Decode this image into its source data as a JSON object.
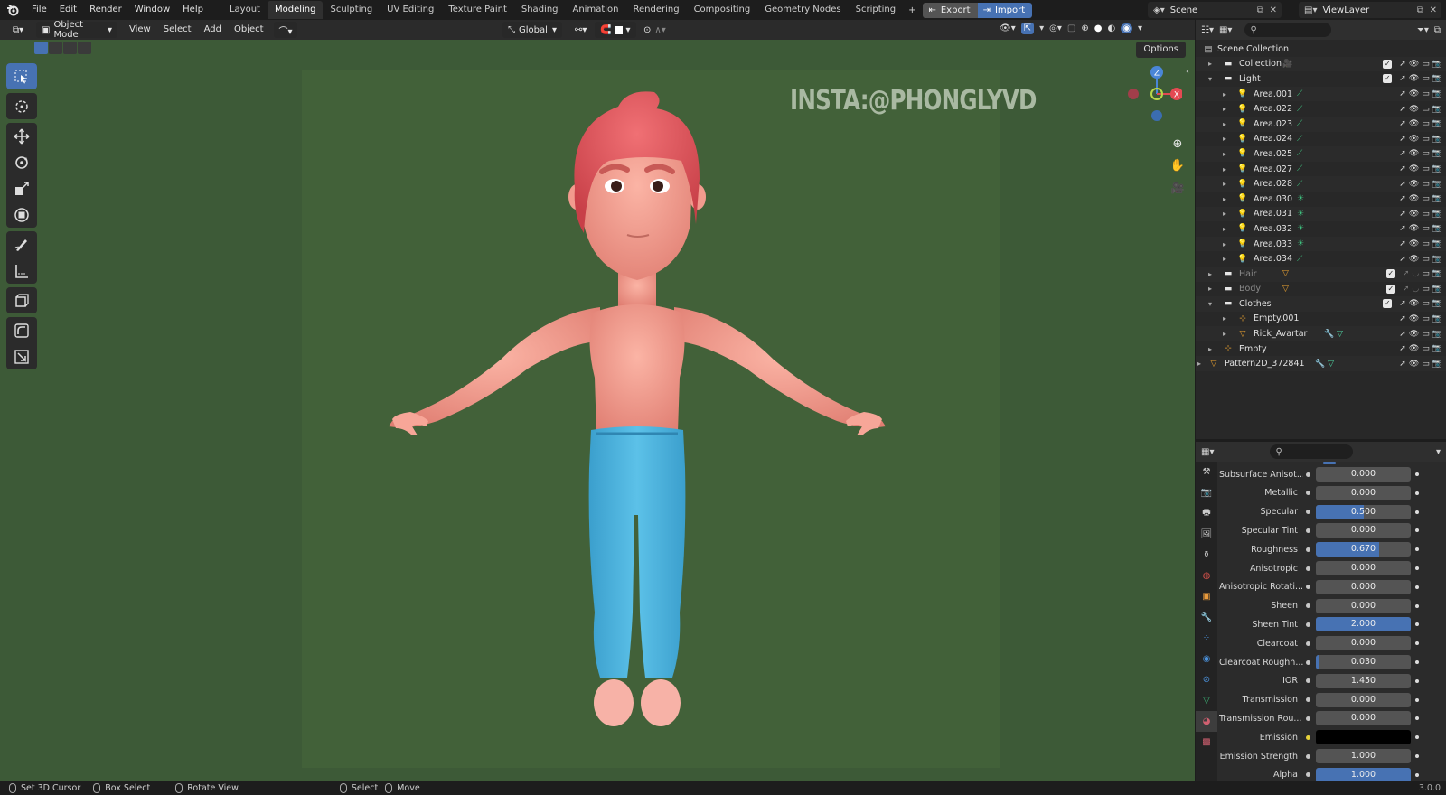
{
  "topbar": {
    "menus": [
      "File",
      "Edit",
      "Render",
      "Window",
      "Help"
    ],
    "workspaces": [
      "Layout",
      "Modeling",
      "Sculpting",
      "UV Editing",
      "Texture Paint",
      "Shading",
      "Animation",
      "Rendering",
      "Compositing",
      "Geometry Nodes",
      "Scripting"
    ],
    "active_workspace": "Modeling",
    "plus": "+",
    "export_label": "Export",
    "import_label": "Import",
    "scene_name": "Scene",
    "view_layer": "ViewLayer"
  },
  "viewport_header": {
    "mode": "Object Mode",
    "menus": [
      "View",
      "Select",
      "Add",
      "Object"
    ],
    "transform_orientation": "Global",
    "options_label": "Options"
  },
  "viewport": {
    "watermark": "INSTA:@PHONGLYVD",
    "gizmo": {
      "x": "X",
      "y": "Y",
      "z": "Z"
    },
    "subject": "Stylized cartoon boy character in T-pose with red hair, shirtless, blue pants",
    "colors": {
      "background": "#3d5a37",
      "frame": "#426139",
      "skin": "#f29b8e",
      "hair": "#e25a5c",
      "pants": "#4fb3dd"
    }
  },
  "outliner": {
    "root": "Scene Collection",
    "rows": [
      {
        "name": "Collection",
        "indent": 1,
        "icon": "collection-icon",
        "extra": "camera-icon",
        "checkbox": true,
        "dim": false
      },
      {
        "name": "Light",
        "indent": 1,
        "icon": "collection-icon",
        "checkbox": true,
        "dim": false,
        "expanded": true
      },
      {
        "name": "Area.001",
        "indent": 2,
        "icon": "light-icon",
        "extra": "area-light-data-icon",
        "dim": false
      },
      {
        "name": "Area.022",
        "indent": 2,
        "icon": "light-icon",
        "extra": "area-light-data-icon",
        "dim": false
      },
      {
        "name": "Area.023",
        "indent": 2,
        "icon": "light-icon",
        "extra": "area-light-data-icon",
        "dim": false
      },
      {
        "name": "Area.024",
        "indent": 2,
        "icon": "light-icon",
        "extra": "area-light-data-icon",
        "dim": false
      },
      {
        "name": "Area.025",
        "indent": 2,
        "icon": "light-icon",
        "extra": "area-light-data-icon",
        "dim": false
      },
      {
        "name": "Area.027",
        "indent": 2,
        "icon": "light-icon",
        "extra": "area-light-data-icon",
        "dim": false
      },
      {
        "name": "Area.028",
        "indent": 2,
        "icon": "light-icon",
        "extra": "area-light-data-icon",
        "dim": false
      },
      {
        "name": "Area.030",
        "indent": 2,
        "icon": "light-icon",
        "extra": "point-light-data-icon",
        "dim": false
      },
      {
        "name": "Area.031",
        "indent": 2,
        "icon": "light-icon",
        "extra": "point-light-data-icon",
        "dim": false
      },
      {
        "name": "Area.032",
        "indent": 2,
        "icon": "light-icon",
        "extra": "point-light-data-icon",
        "dim": false
      },
      {
        "name": "Area.033",
        "indent": 2,
        "icon": "light-icon",
        "extra": "point-light-data-icon",
        "dim": false
      },
      {
        "name": "Area.034",
        "indent": 2,
        "icon": "light-icon",
        "extra": "area-light-data-icon",
        "dim": false
      },
      {
        "name": "Hair",
        "indent": 1,
        "icon": "collection-icon",
        "extra": "mesh-data-icon",
        "checkbox": true,
        "dim": true
      },
      {
        "name": "Body",
        "indent": 1,
        "icon": "collection-icon",
        "extra": "mesh-data-icon",
        "checkbox": true,
        "dim": true
      },
      {
        "name": "Clothes",
        "indent": 1,
        "icon": "collection-icon",
        "checkbox": true,
        "dim": false,
        "expanded": true
      },
      {
        "name": "Empty.001",
        "indent": 2,
        "icon": "empty-icon",
        "dim": false
      },
      {
        "name": "Rick_Avartar",
        "indent": 2,
        "icon": "mesh-icon",
        "extra": "modifier-icon",
        "dim": false
      },
      {
        "name": "Empty",
        "indent": 1,
        "icon": "empty-icon",
        "dim": false
      },
      {
        "name": "Pattern2D_372841",
        "indent": 0,
        "icon": "mesh-icon",
        "extra": "modifier-icon",
        "dim": false
      }
    ]
  },
  "properties": {
    "rows": [
      {
        "label": "Subsurface Anisot...",
        "value": "0.000",
        "fill": 0
      },
      {
        "label": "Metallic",
        "value": "0.000",
        "fill": 0
      },
      {
        "label": "Specular",
        "value": "0.500",
        "fill": 0.5
      },
      {
        "label": "Specular Tint",
        "value": "0.000",
        "fill": 0
      },
      {
        "label": "Roughness",
        "value": "0.670",
        "fill": 0.67
      },
      {
        "label": "Anisotropic",
        "value": "0.000",
        "fill": 0
      },
      {
        "label": "Anisotropic Rotati...",
        "value": "0.000",
        "fill": 0
      },
      {
        "label": "Sheen",
        "value": "0.000",
        "fill": 0
      },
      {
        "label": "Sheen Tint",
        "value": "2.000",
        "fill": 1
      },
      {
        "label": "Clearcoat",
        "value": "0.000",
        "fill": 0
      },
      {
        "label": "Clearcoat Roughn...",
        "value": "0.030",
        "fill": 0.03
      },
      {
        "label": "IOR",
        "value": "1.450",
        "fill": 0
      },
      {
        "label": "Transmission",
        "value": "0.000",
        "fill": 0
      },
      {
        "label": "Transmission Rou...",
        "value": "0.000",
        "fill": 0
      },
      {
        "label": "Emission",
        "value": "",
        "fill": 0,
        "color": "#000000"
      },
      {
        "label": "Emission Strength",
        "value": "1.000",
        "fill": 0
      },
      {
        "label": "Alpha",
        "value": "1.000",
        "fill": 1
      }
    ]
  },
  "statusbar": {
    "items": [
      "Set 3D Cursor",
      "Box Select",
      "Rotate View",
      "Select",
      "Move"
    ],
    "version": "3.0.0"
  }
}
